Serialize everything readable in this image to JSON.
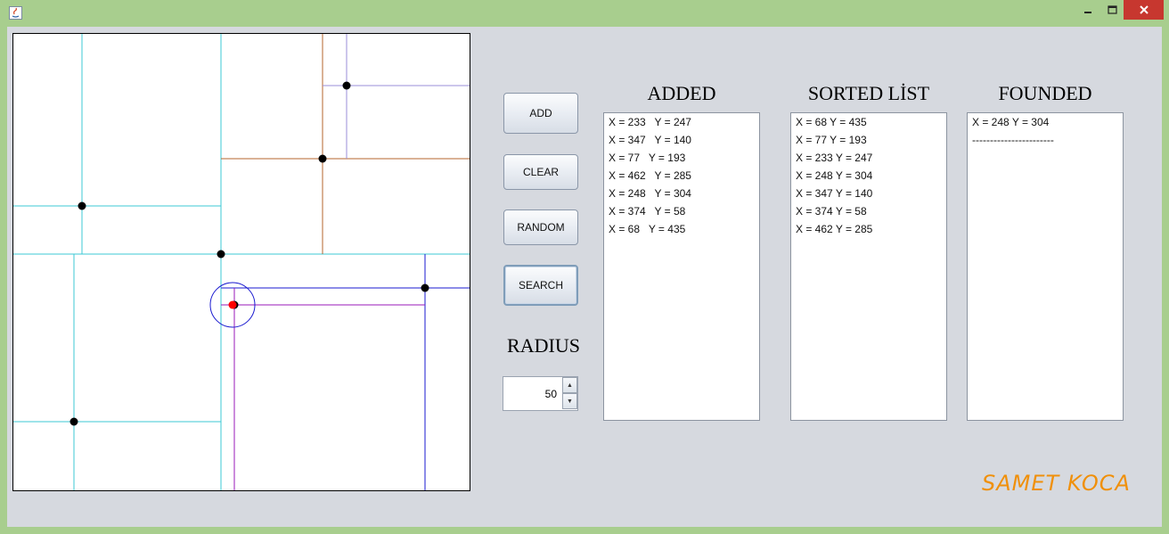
{
  "window": {
    "controls": [
      "minimize",
      "maximize",
      "close"
    ],
    "icons": [
      "java-app-icon",
      "minimize-icon",
      "maximize-icon",
      "close-icon"
    ]
  },
  "buttons": {
    "add": "ADD",
    "clear": "CLEAR",
    "random": "RANDOM",
    "search": "SEARCH"
  },
  "radius": {
    "label": "RADIUS",
    "value": "50"
  },
  "added": {
    "title": "ADDED",
    "items": [
      "X = 233   Y = 247",
      "X = 347   Y = 140",
      "X = 77   Y = 193",
      "X = 462   Y = 285",
      "X = 248   Y = 304",
      "X = 374   Y = 58",
      "X = 68   Y = 435"
    ]
  },
  "sorted": {
    "title": "SORTED LİST",
    "items": [
      "X = 68 Y = 435",
      "X = 77 Y = 193",
      "X = 233 Y = 247",
      "X = 248 Y = 304",
      "X = 347 Y = 140",
      "X = 374 Y = 58",
      "X = 462 Y = 285"
    ]
  },
  "founded": {
    "title": "FOUNDED",
    "items": [
      "X = 248 Y = 304",
      "-----------------------"
    ]
  },
  "author": "SAMET KOCA",
  "colors": {
    "titlebar": "#a8ce8e",
    "panel": "#d6d9df",
    "close": "#c7372f",
    "author": "#f0900a",
    "point": "#000000",
    "query_point": "#ff0000",
    "search_circle": "#1a1ad0"
  }
}
